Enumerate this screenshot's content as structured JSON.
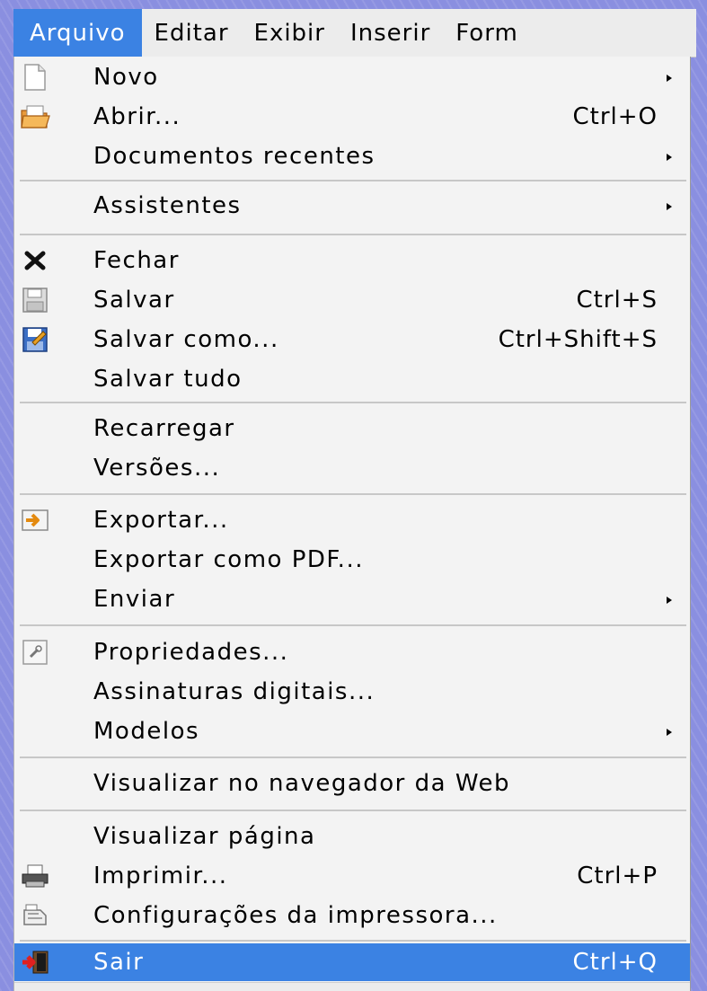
{
  "menubar": {
    "items": [
      "Arquivo",
      "Editar",
      "Exibir",
      "Inserir",
      "Form"
    ]
  },
  "menu": {
    "items": [
      {
        "label": "Novo",
        "shortcut": "",
        "submenu": true,
        "icon": "new-document-icon"
      },
      {
        "label": "Abrir...",
        "shortcut": "Ctrl+O",
        "submenu": false,
        "icon": "open-folder-icon"
      },
      {
        "label": "Documentos recentes",
        "shortcut": "",
        "submenu": true,
        "icon": ""
      },
      {
        "label": "Assistentes",
        "shortcut": "",
        "submenu": true,
        "icon": ""
      },
      {
        "label": "Fechar",
        "shortcut": "",
        "submenu": false,
        "icon": "close-icon"
      },
      {
        "label": "Salvar",
        "shortcut": "Ctrl+S",
        "submenu": false,
        "icon": "save-icon"
      },
      {
        "label": "Salvar como...",
        "shortcut": "Ctrl+Shift+S",
        "submenu": false,
        "icon": "save-as-icon"
      },
      {
        "label": "Salvar tudo",
        "shortcut": "",
        "submenu": false,
        "icon": ""
      },
      {
        "label": "Recarregar",
        "shortcut": "",
        "submenu": false,
        "icon": ""
      },
      {
        "label": "Versões...",
        "shortcut": "",
        "submenu": false,
        "icon": ""
      },
      {
        "label": "Exportar...",
        "shortcut": "",
        "submenu": false,
        "icon": "export-icon"
      },
      {
        "label": "Exportar como PDF...",
        "shortcut": "",
        "submenu": false,
        "icon": ""
      },
      {
        "label": "Enviar",
        "shortcut": "",
        "submenu": true,
        "icon": ""
      },
      {
        "label": "Propriedades...",
        "shortcut": "",
        "submenu": false,
        "icon": "properties-icon"
      },
      {
        "label": "Assinaturas digitais...",
        "shortcut": "",
        "submenu": false,
        "icon": ""
      },
      {
        "label": "Modelos",
        "shortcut": "",
        "submenu": true,
        "icon": ""
      },
      {
        "label": "Visualizar no navegador da Web",
        "shortcut": "",
        "submenu": false,
        "icon": ""
      },
      {
        "label": "Visualizar página",
        "shortcut": "",
        "submenu": false,
        "icon": ""
      },
      {
        "label": "Imprimir...",
        "shortcut": "Ctrl+P",
        "submenu": false,
        "icon": "printer-icon"
      },
      {
        "label": "Configurações da impressora...",
        "shortcut": "",
        "submenu": false,
        "icon": "printer-settings-icon"
      },
      {
        "label": "Sair",
        "shortcut": "Ctrl+Q",
        "submenu": false,
        "icon": "exit-icon",
        "selected": true
      }
    ]
  },
  "colors": {
    "highlight": "#3b82e3",
    "menu_bg": "#f3f3f3",
    "desktop": "#8a8fe0"
  }
}
